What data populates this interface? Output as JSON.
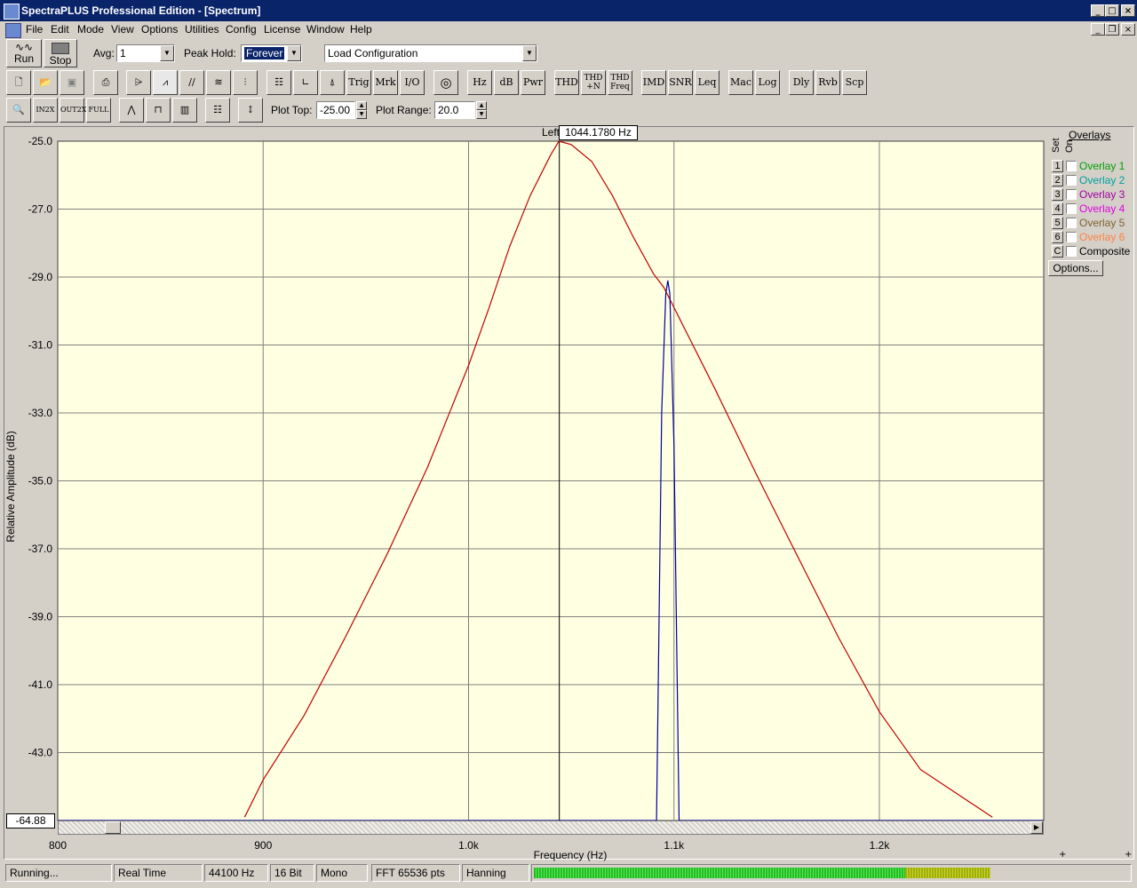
{
  "window": {
    "title": "SpectraPLUS Professional Edition - [Spectrum]"
  },
  "menu": [
    "File",
    "Edit",
    "Mode",
    "View",
    "Options",
    "Utilities",
    "Config",
    "License",
    "Window",
    "Help"
  ],
  "toolbar1": {
    "run_label": "Run",
    "stop_label": "Stop",
    "avg_label": "Avg:",
    "avg_value": "1",
    "peak_hold_label": "Peak Hold:",
    "peak_hold_value": "Forever",
    "config_value": "Load Configuration"
  },
  "toolbar2": {
    "buttons": [
      "Trig",
      "Mrk",
      "I/O",
      "Hz",
      "dB",
      "Pwr",
      "THD",
      "THD +N",
      "THD Freq",
      "IMD",
      "SNR",
      "Leq",
      "Mac",
      "Log",
      "Dly",
      "Rvb",
      "Scp"
    ]
  },
  "toolbar3": {
    "plot_top_label": "Plot Top:",
    "plot_top_value": "-25.00",
    "plot_range_label": "Plot Range:",
    "plot_range_value": "20.0"
  },
  "plot": {
    "channel_label": "Left",
    "cursor_readout": "1044.1780 Hz",
    "cursor_hz": 1044.178,
    "value_readout": "-64.88",
    "bg_color": "#ffffe1",
    "grid_color": "#808080",
    "series_colors": {
      "left": "#c00000",
      "right": "#0000a0"
    }
  },
  "chart_data": {
    "type": "line",
    "xlabel": "Frequency (Hz)",
    "ylabel": "Relative Amplitude (dB)",
    "xlim": [
      800,
      1280
    ],
    "ylim": [
      -45,
      -25
    ],
    "x_ticks": [
      {
        "v": 800,
        "label": "800"
      },
      {
        "v": 900,
        "label": "900"
      },
      {
        "v": 1000,
        "label": "1.0k"
      },
      {
        "v": 1100,
        "label": "1.1k"
      },
      {
        "v": 1200,
        "label": "1.2k"
      }
    ],
    "y_ticks": [
      {
        "v": -25,
        "label": "-25.0"
      },
      {
        "v": -27,
        "label": "-27.0"
      },
      {
        "v": -29,
        "label": "-29.0"
      },
      {
        "v": -31,
        "label": "-31.0"
      },
      {
        "v": -33,
        "label": "-33.0"
      },
      {
        "v": -35,
        "label": "-35.0"
      },
      {
        "v": -37,
        "label": "-37.0"
      },
      {
        "v": -39,
        "label": "-39.0"
      },
      {
        "v": -41,
        "label": "-41.0"
      },
      {
        "v": -43,
        "label": "-43.0"
      }
    ],
    "grid": true,
    "series": [
      {
        "color": "#c00000",
        "x": [
          891,
          900,
          920,
          940,
          960,
          980,
          1000,
          1010,
          1020,
          1030,
          1040,
          1044,
          1050,
          1060,
          1070,
          1080,
          1090,
          1095,
          1100,
          1110,
          1120,
          1140,
          1160,
          1180,
          1200,
          1220,
          1240,
          1255
        ],
        "y": [
          -44.9,
          -43.8,
          -41.9,
          -39.6,
          -37.2,
          -34.6,
          -31.6,
          -29.9,
          -28.1,
          -26.6,
          -25.4,
          -25.0,
          -25.1,
          -25.6,
          -26.6,
          -27.8,
          -28.9,
          -29.3,
          -29.9,
          -31.1,
          -32.3,
          -34.8,
          -37.2,
          -39.6,
          -41.8,
          -43.5,
          -44.3,
          -44.9
        ]
      },
      {
        "color": "#0000a0",
        "x": [
          800,
          1091.5,
          1094,
          1096,
          1097,
          1098,
          1100,
          1102.5,
          1280
        ],
        "y": [
          -45,
          -45,
          -33,
          -29.5,
          -29.1,
          -29.5,
          -34,
          -45,
          -45
        ]
      }
    ]
  },
  "overlays": {
    "header": "Overlays",
    "set_label": "Set",
    "on_label": "On",
    "items": [
      {
        "num": "1",
        "name": "Overlay 1",
        "color": "#00a000"
      },
      {
        "num": "2",
        "name": "Overlay 2",
        "color": "#00a0a0"
      },
      {
        "num": "3",
        "name": "Overlay 3",
        "color": "#a000a0"
      },
      {
        "num": "4",
        "name": "Overlay 4",
        "color": "#e000e0"
      },
      {
        "num": "5",
        "name": "Overlay 5",
        "color": "#806030"
      },
      {
        "num": "6",
        "name": "Overlay 6",
        "color": "#ff8040"
      },
      {
        "num": "C",
        "name": "Composite",
        "color": "#000000"
      }
    ],
    "options_label": "Options..."
  },
  "status": {
    "state": "Running...",
    "mode": "Real Time",
    "rate": "44100 Hz",
    "bits": "16 Bit",
    "channels": "Mono",
    "fft": "FFT 65536 pts",
    "window": "Hanning"
  }
}
